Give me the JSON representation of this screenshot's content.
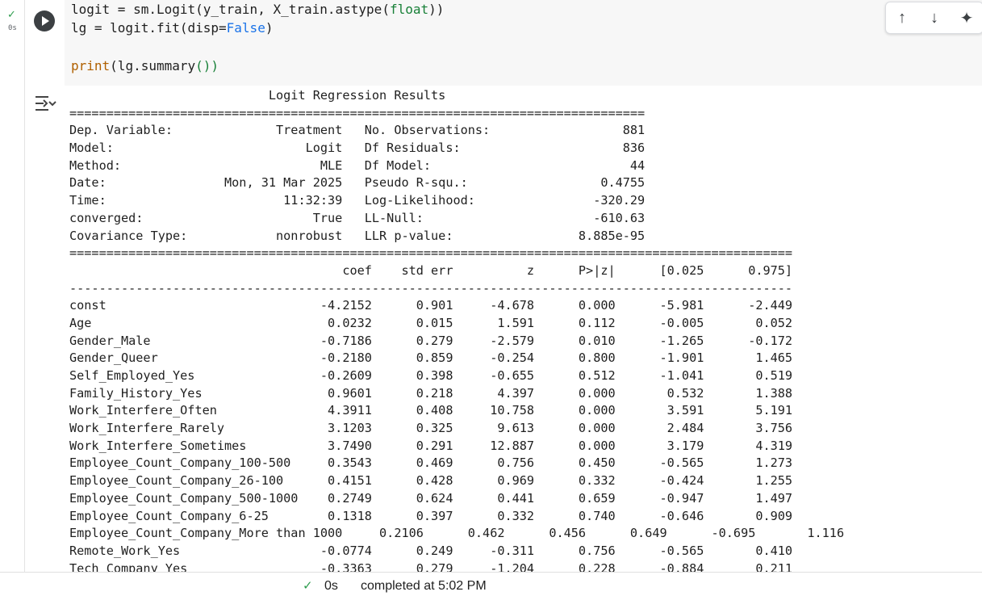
{
  "cell": {
    "exec_check": "✓",
    "exec_time": "0s",
    "code_lines": [
      {
        "a": "logit = sm.Logit(y_train, X_train.astype(",
        "b": "float",
        "c": "))"
      },
      {
        "a": "lg = logit.fit(disp=",
        "b": "False",
        "c": ")"
      },
      {
        "a": "",
        "b": "",
        "c": ""
      },
      {
        "a": "print",
        "b": "(lg.summary",
        "c": "())"
      }
    ]
  },
  "toolbar": {
    "up_label": "↑",
    "down_label": "↓",
    "gemini_label": "✦"
  },
  "output": {
    "lines": [
      "                           Logit Regression Results                           ",
      "==============================================================================",
      "Dep. Variable:              Treatment   No. Observations:                  881",
      "Model:                          Logit   Df Residuals:                      836",
      "Method:                           MLE   Df Model:                           44",
      "Date:                Mon, 31 Mar 2025   Pseudo R-squ.:                  0.4755",
      "Time:                        11:32:39   Log-Likelihood:                -320.29",
      "converged:                       True   LL-Null:                       -610.63",
      "Covariance Type:            nonrobust   LLR p-value:                 8.885e-95",
      "==================================================================================================",
      "                                     coef    std err          z      P>|z|      [0.025      0.975]",
      "--------------------------------------------------------------------------------------------------",
      "const                             -4.2152      0.901     -4.678      0.000      -5.981      -2.449",
      "Age                                0.0232      0.015      1.591      0.112      -0.005       0.052",
      "Gender_Male                       -0.7186      0.279     -2.579      0.010      -1.265      -0.172",
      "Gender_Queer                      -0.2180      0.859     -0.254      0.800      -1.901       1.465",
      "Self_Employed_Yes                 -0.2609      0.398     -0.655      0.512      -1.041       0.519",
      "Family_History_Yes                 0.9601      0.218      4.397      0.000       0.532       1.388",
      "Work_Interfere_Often               4.3911      0.408     10.758      0.000       3.591       5.191",
      "Work_Interfere_Rarely              3.1203      0.325      9.613      0.000       2.484       3.756",
      "Work_Interfere_Sometimes           3.7490      0.291     12.887      0.000       3.179       4.319",
      "Employee_Count_Company_100-500     0.3543      0.469      0.756      0.450      -0.565       1.273",
      "Employee_Count_Company_26-100      0.4151      0.428      0.969      0.332      -0.424       1.255",
      "Employee_Count_Company_500-1000    0.2749      0.624      0.441      0.659      -0.947       1.497",
      "Employee_Count_Company_6-25        0.1318      0.397      0.332      0.740      -0.646       0.909",
      "Employee_Count_Company_More than 1000     0.2106      0.462      0.456      0.649      -0.695       1.116",
      "Remote_Work_Yes                   -0.0774      0.249     -0.311      0.756      -0.565       0.410",
      "Tech_Company_Yes                  -0.3363      0.279     -1.204      0.228      -0.884       0.211"
    ]
  },
  "statusbar": {
    "check": "✓",
    "time": "0s",
    "text": "completed at 5:02 PM"
  }
}
